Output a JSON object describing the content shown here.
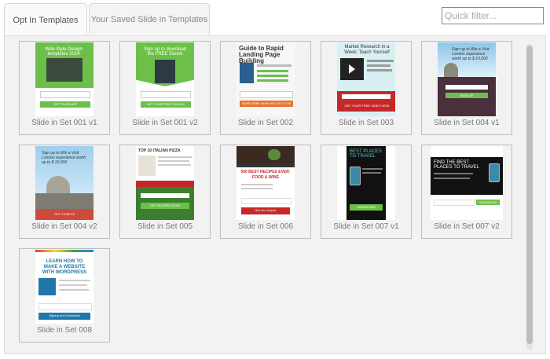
{
  "tabs": [
    {
      "label": "Opt In Templates",
      "active": true
    },
    {
      "label": "Your Saved Slide in Templates",
      "active": false
    }
  ],
  "filter": {
    "placeholder": "Quick filter..."
  },
  "templates": [
    {
      "caption": "Slide in Set 001 v1",
      "theme": "green",
      "headline": "Web Style Design templates 2014",
      "button": "GET TEMPLATE"
    },
    {
      "caption": "Slide in Set 001 v2",
      "theme": "green-book",
      "headline": "Sign up to download the FREE Ebook",
      "button": "GET YOUR FREE EBOOK"
    },
    {
      "caption": "Slide in Set 002",
      "theme": "guide",
      "headline": "Guide to Rapid Landing Page Building",
      "button": "SUBSCRIBE NOW AND GET OUR GUIDE"
    },
    {
      "caption": "Slide in Set 003",
      "theme": "video",
      "headline": "Market Research in a Week: Teach Yourself",
      "button": "GET YOUR FREE VIDEO NOW"
    },
    {
      "caption": "Slide in Set 004 v1",
      "theme": "london",
      "headline": "Sign up to Win a Visit London experience worth up to $ 10,000",
      "button": "SIGN UP"
    },
    {
      "caption": "Slide in Set 004 v2",
      "theme": "london2",
      "headline": "Sign up to Win a Visit London experience worth up to $ 10,000",
      "button": "GET TICKETS"
    },
    {
      "caption": "Slide in Set 005",
      "theme": "pizza",
      "headline": "TOP 10 ITALIAN PIZZA",
      "button": "GET RECIPES NOW"
    },
    {
      "caption": "Slide in Set 006",
      "theme": "food",
      "headline": "500 BEST RECIPES EVER: FOOD & WINE",
      "button": "Get our recipes"
    },
    {
      "caption": "Slide in Set 007 v1",
      "theme": "travel",
      "headline": "BEST PLACES TO TRAVEL",
      "button": "DOWNLOAD"
    },
    {
      "caption": "Slide in Set 007 v2",
      "theme": "travel-wide",
      "headline": "FIND THE BEST PLACES TO TRAVEL",
      "button": "DOWNLOAD"
    },
    {
      "caption": "Slide in Set 008",
      "theme": "wordpress",
      "headline": "LEARN HOW TO MAKE A WEBSITE WITH WORDPRESS",
      "button": "Signup and Download"
    }
  ]
}
